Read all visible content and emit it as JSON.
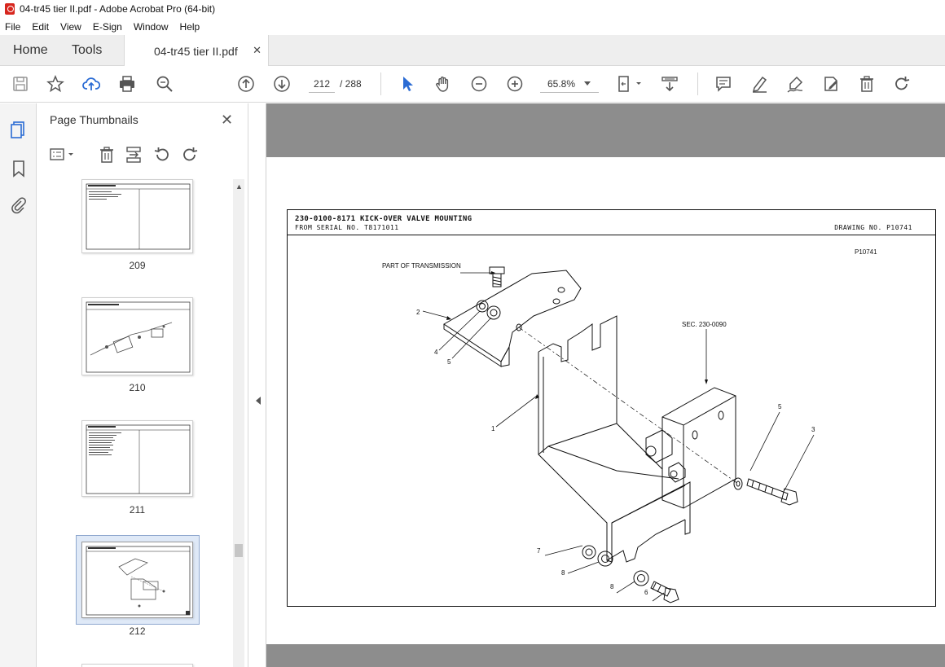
{
  "window": {
    "title": "04-tr45 tier II.pdf - Adobe Acrobat Pro (64-bit)"
  },
  "menu": [
    "File",
    "Edit",
    "View",
    "E-Sign",
    "Window",
    "Help"
  ],
  "tabs": {
    "home": "Home",
    "tools": "Tools",
    "document": "04-tr45 tier II.pdf"
  },
  "toolbar": {
    "page_current": "212",
    "page_total": "/ 288",
    "zoom": "65.8%"
  },
  "thumbnails": {
    "title": "Page Thumbnails",
    "pages": [
      {
        "number": "209",
        "selected": false
      },
      {
        "number": "210",
        "selected": false
      },
      {
        "number": "211",
        "selected": false
      },
      {
        "number": "212",
        "selected": true
      }
    ]
  },
  "document": {
    "part_title": "230-0100-8171 KICK-OVER VALVE MOUNTING",
    "serial": "FROM SERIAL NO. T8171011",
    "drawing_no": "DRAWING NO. P10741",
    "drawing_tag": "P10741",
    "callouts": {
      "transmission": "PART OF TRANSMISSION",
      "section": "SEC. 230-0090",
      "c1": "1",
      "c2": "2",
      "c3": "3",
      "c4": "4",
      "c5a": "5",
      "c5b": "5",
      "c6": "6",
      "c7": "7",
      "c8a": "8",
      "c8b": "8"
    }
  },
  "colors": {
    "accent": "#2b6cd4",
    "pdf_red": "#d7261e",
    "doc_bg": "#8d8d8d"
  }
}
